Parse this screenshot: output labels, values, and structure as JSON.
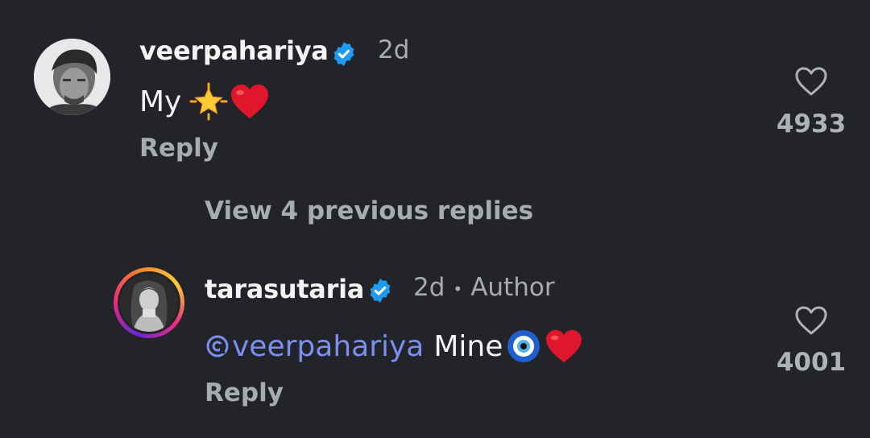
{
  "comment": {
    "username": "veerpahariya",
    "time": "2d",
    "text_prefix": "My",
    "reply_label": "Reply",
    "likes": "4933"
  },
  "view_previous": "View 4 previous replies",
  "reply": {
    "username": "tarasutaria",
    "time": "2d",
    "separator": "•",
    "badge": "Author",
    "mention": "veerpahariya",
    "text": "Mine",
    "reply_label": "Reply",
    "likes": "4001"
  },
  "colors": {
    "background": "#23242a",
    "verified": "#1d9bf0",
    "mention": "#7b8ff0",
    "story_ring": [
      "#f9ce34",
      "#ee2a7b",
      "#6228d7"
    ]
  },
  "icons": [
    "verified-badge-icon",
    "star-emoji-icon",
    "heart-emoji-icon",
    "nazar-emoji-icon",
    "threads-at-icon",
    "like-heart-icon"
  ]
}
